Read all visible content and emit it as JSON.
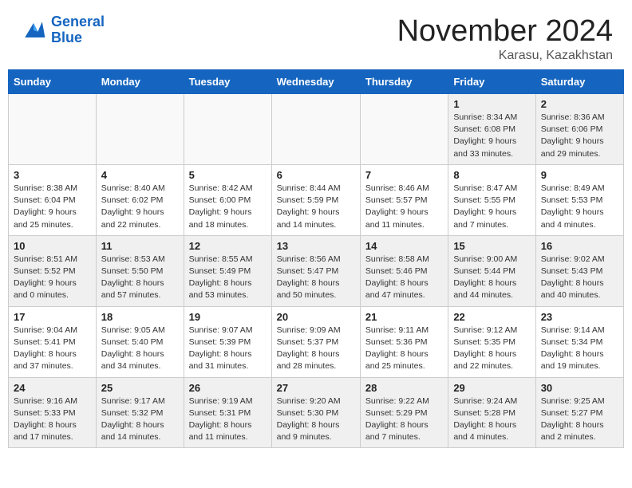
{
  "header": {
    "logo_line1": "General",
    "logo_line2": "Blue",
    "month": "November 2024",
    "location": "Karasu, Kazakhstan"
  },
  "weekdays": [
    "Sunday",
    "Monday",
    "Tuesday",
    "Wednesday",
    "Thursday",
    "Friday",
    "Saturday"
  ],
  "weeks": [
    [
      {
        "day": "",
        "info": ""
      },
      {
        "day": "",
        "info": ""
      },
      {
        "day": "",
        "info": ""
      },
      {
        "day": "",
        "info": ""
      },
      {
        "day": "",
        "info": ""
      },
      {
        "day": "1",
        "info": "Sunrise: 8:34 AM\nSunset: 6:08 PM\nDaylight: 9 hours and 33 minutes."
      },
      {
        "day": "2",
        "info": "Sunrise: 8:36 AM\nSunset: 6:06 PM\nDaylight: 9 hours and 29 minutes."
      }
    ],
    [
      {
        "day": "3",
        "info": "Sunrise: 8:38 AM\nSunset: 6:04 PM\nDaylight: 9 hours and 25 minutes."
      },
      {
        "day": "4",
        "info": "Sunrise: 8:40 AM\nSunset: 6:02 PM\nDaylight: 9 hours and 22 minutes."
      },
      {
        "day": "5",
        "info": "Sunrise: 8:42 AM\nSunset: 6:00 PM\nDaylight: 9 hours and 18 minutes."
      },
      {
        "day": "6",
        "info": "Sunrise: 8:44 AM\nSunset: 5:59 PM\nDaylight: 9 hours and 14 minutes."
      },
      {
        "day": "7",
        "info": "Sunrise: 8:46 AM\nSunset: 5:57 PM\nDaylight: 9 hours and 11 minutes."
      },
      {
        "day": "8",
        "info": "Sunrise: 8:47 AM\nSunset: 5:55 PM\nDaylight: 9 hours and 7 minutes."
      },
      {
        "day": "9",
        "info": "Sunrise: 8:49 AM\nSunset: 5:53 PM\nDaylight: 9 hours and 4 minutes."
      }
    ],
    [
      {
        "day": "10",
        "info": "Sunrise: 8:51 AM\nSunset: 5:52 PM\nDaylight: 9 hours and 0 minutes."
      },
      {
        "day": "11",
        "info": "Sunrise: 8:53 AM\nSunset: 5:50 PM\nDaylight: 8 hours and 57 minutes."
      },
      {
        "day": "12",
        "info": "Sunrise: 8:55 AM\nSunset: 5:49 PM\nDaylight: 8 hours and 53 minutes."
      },
      {
        "day": "13",
        "info": "Sunrise: 8:56 AM\nSunset: 5:47 PM\nDaylight: 8 hours and 50 minutes."
      },
      {
        "day": "14",
        "info": "Sunrise: 8:58 AM\nSunset: 5:46 PM\nDaylight: 8 hours and 47 minutes."
      },
      {
        "day": "15",
        "info": "Sunrise: 9:00 AM\nSunset: 5:44 PM\nDaylight: 8 hours and 44 minutes."
      },
      {
        "day": "16",
        "info": "Sunrise: 9:02 AM\nSunset: 5:43 PM\nDaylight: 8 hours and 40 minutes."
      }
    ],
    [
      {
        "day": "17",
        "info": "Sunrise: 9:04 AM\nSunset: 5:41 PM\nDaylight: 8 hours and 37 minutes."
      },
      {
        "day": "18",
        "info": "Sunrise: 9:05 AM\nSunset: 5:40 PM\nDaylight: 8 hours and 34 minutes."
      },
      {
        "day": "19",
        "info": "Sunrise: 9:07 AM\nSunset: 5:39 PM\nDaylight: 8 hours and 31 minutes."
      },
      {
        "day": "20",
        "info": "Sunrise: 9:09 AM\nSunset: 5:37 PM\nDaylight: 8 hours and 28 minutes."
      },
      {
        "day": "21",
        "info": "Sunrise: 9:11 AM\nSunset: 5:36 PM\nDaylight: 8 hours and 25 minutes."
      },
      {
        "day": "22",
        "info": "Sunrise: 9:12 AM\nSunset: 5:35 PM\nDaylight: 8 hours and 22 minutes."
      },
      {
        "day": "23",
        "info": "Sunrise: 9:14 AM\nSunset: 5:34 PM\nDaylight: 8 hours and 19 minutes."
      }
    ],
    [
      {
        "day": "24",
        "info": "Sunrise: 9:16 AM\nSunset: 5:33 PM\nDaylight: 8 hours and 17 minutes."
      },
      {
        "day": "25",
        "info": "Sunrise: 9:17 AM\nSunset: 5:32 PM\nDaylight: 8 hours and 14 minutes."
      },
      {
        "day": "26",
        "info": "Sunrise: 9:19 AM\nSunset: 5:31 PM\nDaylight: 8 hours and 11 minutes."
      },
      {
        "day": "27",
        "info": "Sunrise: 9:20 AM\nSunset: 5:30 PM\nDaylight: 8 hours and 9 minutes."
      },
      {
        "day": "28",
        "info": "Sunrise: 9:22 AM\nSunset: 5:29 PM\nDaylight: 8 hours and 7 minutes."
      },
      {
        "day": "29",
        "info": "Sunrise: 9:24 AM\nSunset: 5:28 PM\nDaylight: 8 hours and 4 minutes."
      },
      {
        "day": "30",
        "info": "Sunrise: 9:25 AM\nSunset: 5:27 PM\nDaylight: 8 hours and 2 minutes."
      }
    ]
  ]
}
